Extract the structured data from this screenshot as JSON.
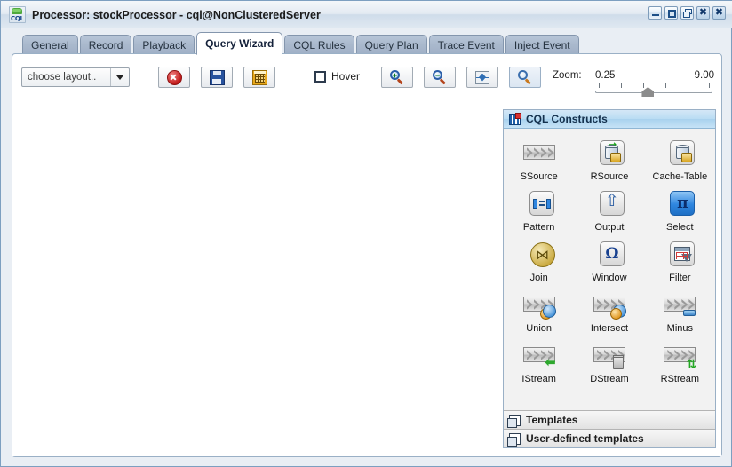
{
  "window": {
    "title": "Processor: stockProcessor - cql@NonClusteredServer",
    "app_icon": "cql-app-icon",
    "buttons": [
      {
        "name": "minimize",
        "glyph": ""
      },
      {
        "name": "maximize",
        "glyph": ""
      },
      {
        "name": "restore",
        "glyph": ""
      },
      {
        "name": "close-view",
        "glyph": "✖"
      },
      {
        "name": "close-window",
        "glyph": "✖"
      }
    ]
  },
  "tabs": [
    {
      "label": "General",
      "selected": false
    },
    {
      "label": "Record",
      "selected": false
    },
    {
      "label": "Playback",
      "selected": false
    },
    {
      "label": "Query Wizard",
      "selected": true
    },
    {
      "label": "CQL Rules",
      "selected": false
    },
    {
      "label": "Query Plan",
      "selected": false
    },
    {
      "label": "Trace Event",
      "selected": false
    },
    {
      "label": "Inject Event",
      "selected": false
    }
  ],
  "toolbar": {
    "layout_combo": {
      "value": "choose layout..",
      "icon": "chevron-down-icon"
    },
    "buttons": [
      {
        "name": "delete-button",
        "icon": "red-x-circle-icon"
      },
      {
        "name": "save-button",
        "icon": "floppy-disk-icon"
      },
      {
        "name": "grid-button",
        "icon": "yellow-grid-icon"
      }
    ],
    "hover": {
      "label": "Hover",
      "checked": false
    },
    "zoom_buttons": [
      {
        "name": "zoom-in-button",
        "icon": "magnifier-plus-icon"
      },
      {
        "name": "zoom-out-button",
        "icon": "magnifier-minus-icon"
      },
      {
        "name": "zoom-fit-button",
        "icon": "fit-to-window-icon"
      },
      {
        "name": "zoom-actual-button",
        "icon": "magnifier-icon",
        "active": true
      }
    ],
    "zoom_slider": {
      "label": "Zoom:",
      "min": "0.25",
      "max": "9.00",
      "thumb_percent": 45,
      "tick_count": 6
    }
  },
  "palette": {
    "sections": [
      {
        "title": "CQL Constructs",
        "icon": "constructs-icon",
        "expanded": true,
        "items": [
          {
            "label": "SSource",
            "icon": "chevron-stream-icon"
          },
          {
            "label": "RSource",
            "icon": "database-arrows-icon"
          },
          {
            "label": "Cache-Table",
            "icon": "database-icon"
          },
          {
            "label": "Pattern",
            "icon": "pattern-icon"
          },
          {
            "label": "Output",
            "icon": "output-arrows-icon"
          },
          {
            "label": "Select",
            "icon": "pi-select-icon",
            "selected": true
          },
          {
            "label": "Join",
            "icon": "bowtie-join-icon"
          },
          {
            "label": "Window",
            "icon": "omega-window-icon"
          },
          {
            "label": "Filter",
            "icon": "table-funnel-filter-icon"
          },
          {
            "label": "Union",
            "icon": "stream-union-icon"
          },
          {
            "label": "Intersect",
            "icon": "stream-intersect-icon"
          },
          {
            "label": "Minus",
            "icon": "stream-minus-icon"
          },
          {
            "label": "IStream",
            "icon": "stream-insert-icon"
          },
          {
            "label": "DStream",
            "icon": "stream-delete-icon"
          },
          {
            "label": "RStream",
            "icon": "stream-relation-icon"
          }
        ]
      },
      {
        "title": "Templates",
        "icon": "page-icon",
        "expanded": false
      },
      {
        "title": "User-defined templates",
        "icon": "page-icon",
        "expanded": false
      }
    ]
  },
  "canvas": {
    "content": ""
  }
}
